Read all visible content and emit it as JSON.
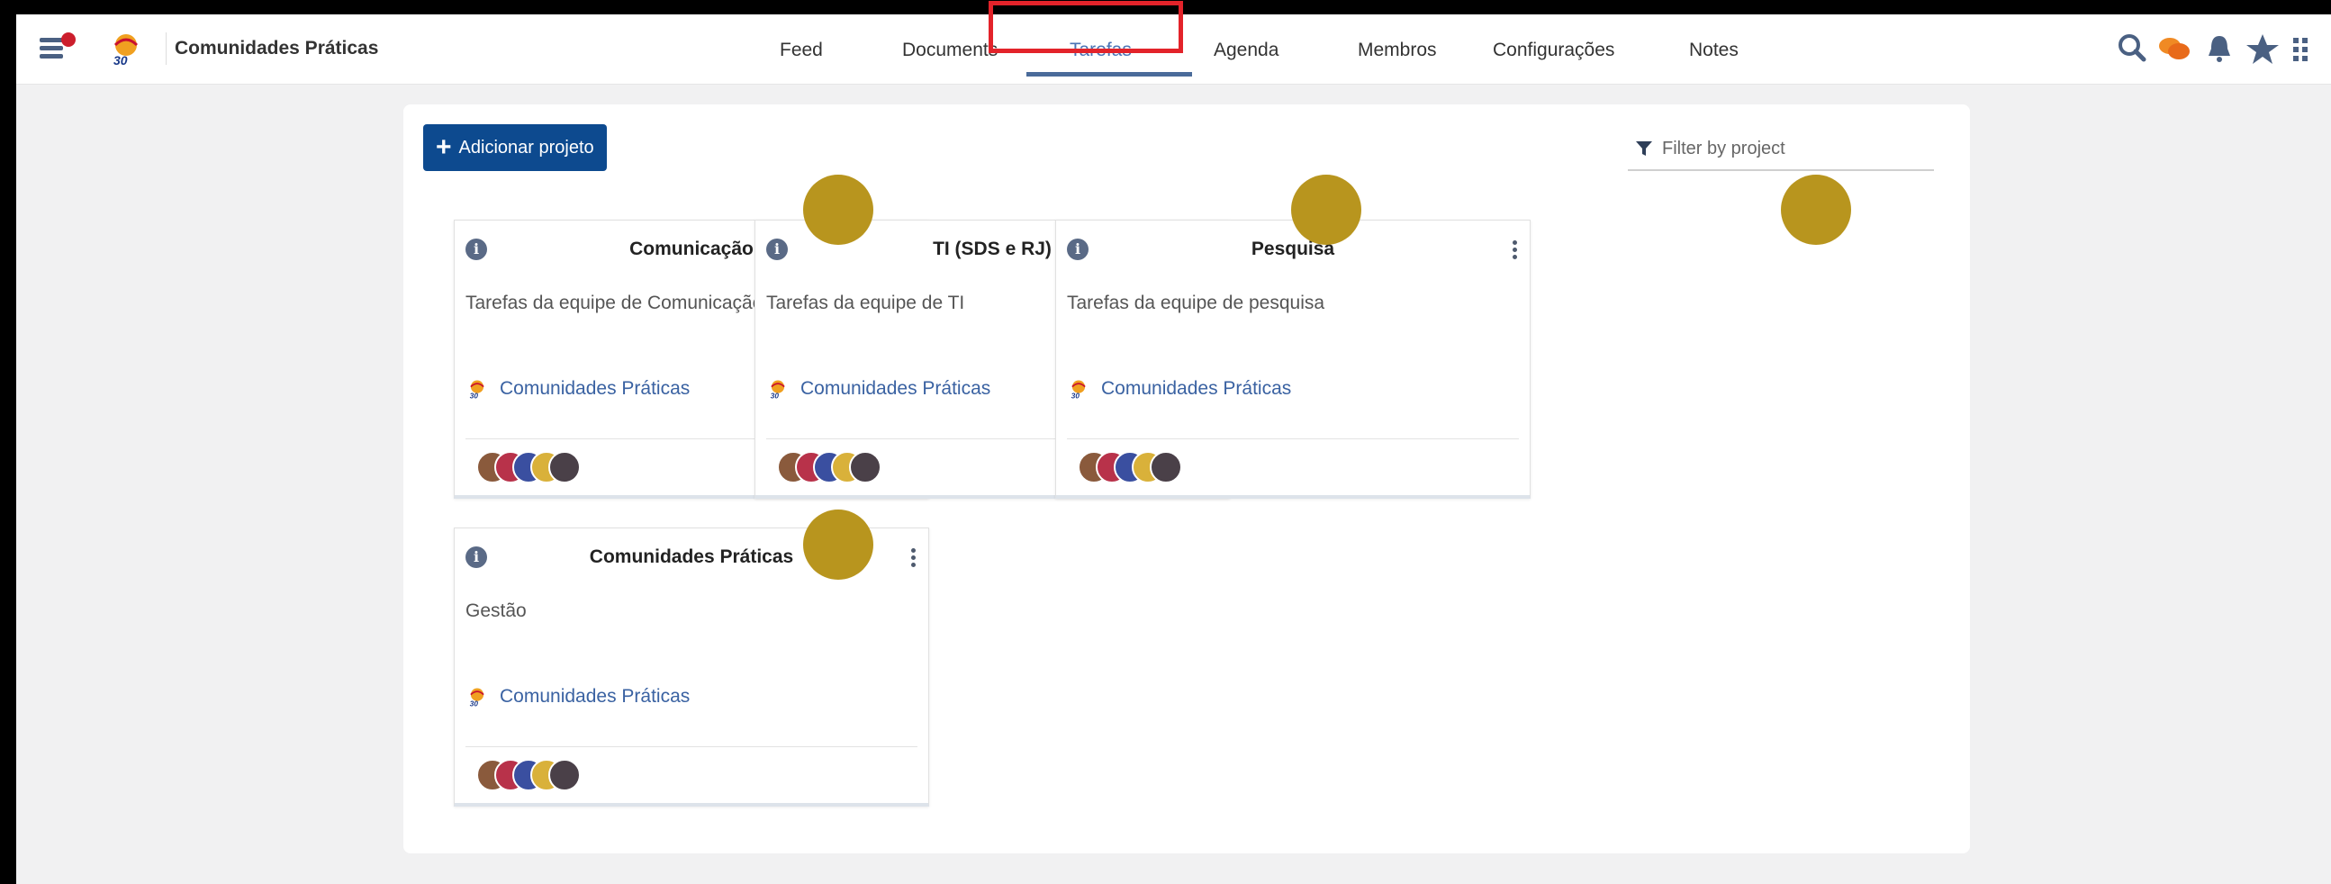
{
  "topbar": {
    "space_name": "Comunidades Práticas",
    "nav": [
      "Feed",
      "Documents",
      "Tarefas",
      "Agenda",
      "Membros",
      "Configurações",
      "Notes"
    ],
    "active_tab": "Tarefas",
    "icons": [
      "search-icon",
      "chat-icon",
      "bell-icon",
      "star-icon",
      "apps-grid-icon"
    ]
  },
  "toolbar": {
    "add_label": "Adicionar projeto",
    "filter_placeholder": "Filter by project"
  },
  "cards": [
    {
      "title": "Comunicação",
      "description": "Tarefas da equipe de Comunicação",
      "space": "Comunidades Práticas"
    },
    {
      "title": "TI (SDS e RJ)",
      "description": "Tarefas da equipe de TI",
      "space": "Comunidades Práticas"
    },
    {
      "title": "Pesquisa",
      "description": "Tarefas da equipe de pesquisa",
      "space": "Comunidades Práticas"
    },
    {
      "title": "Comunidades Práticas",
      "description": "Gestão",
      "space": "Comunidades Práticas"
    }
  ],
  "colors": {
    "accent": "#0d4a8f",
    "link": "#3a62a2",
    "highlight": "#e3232a",
    "marker": "#b8951e"
  }
}
